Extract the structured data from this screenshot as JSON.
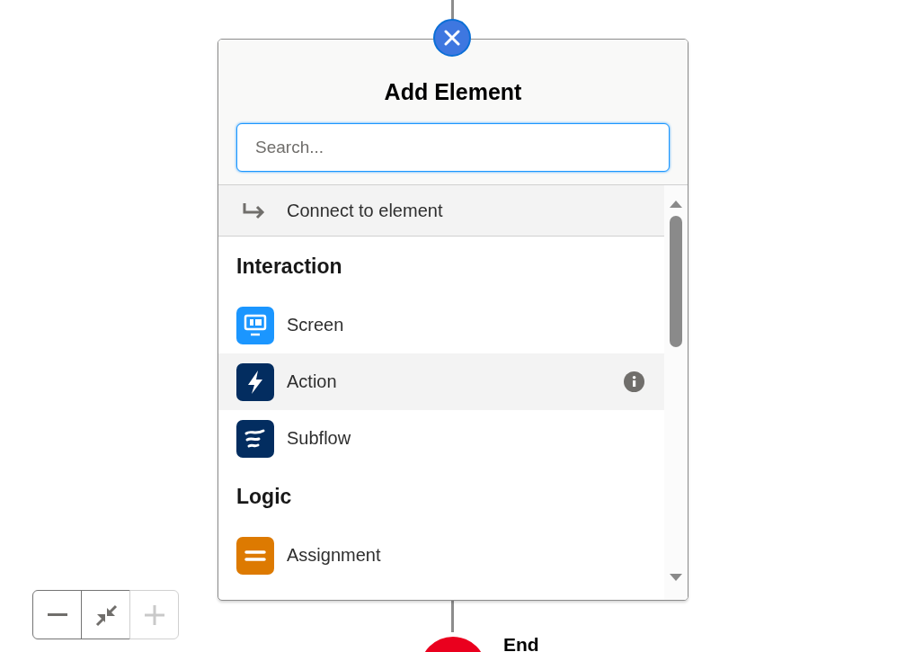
{
  "popover": {
    "title": "Add Element",
    "search": {
      "placeholder": "Search..."
    },
    "items": [
      {
        "kind": "connect",
        "label": "Connect to element",
        "highlighted": true
      },
      {
        "kind": "header",
        "label": "Interaction"
      },
      {
        "kind": "screen",
        "color": "#1b96ff",
        "label": "Screen",
        "highlighted": false,
        "info": false
      },
      {
        "kind": "action",
        "color": "#032d60",
        "label": "Action",
        "highlighted": true,
        "info": true
      },
      {
        "kind": "subflow",
        "color": "#032d60",
        "label": "Subflow",
        "highlighted": false,
        "info": false
      },
      {
        "kind": "header",
        "label": "Logic"
      },
      {
        "kind": "assignment",
        "color": "#dd7a01",
        "label": "Assignment",
        "highlighted": false,
        "info": false
      }
    ]
  },
  "zoom_controls": [
    {
      "kind": "zoom_out",
      "disabled": false
    },
    {
      "kind": "fit",
      "disabled": false
    },
    {
      "kind": "zoom_in",
      "disabled": true
    }
  ],
  "end_node": {
    "label": "End"
  }
}
